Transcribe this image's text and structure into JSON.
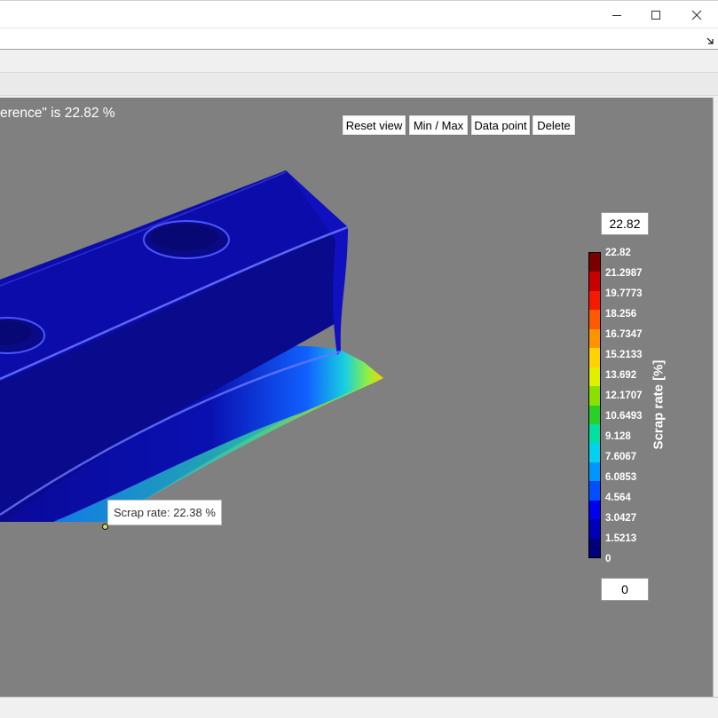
{
  "window": {
    "controls": [
      "minimize",
      "maximize",
      "close"
    ]
  },
  "viewport": {
    "heading": "erence\" is 22.82 %",
    "toolbar": {
      "reset_view": "Reset view",
      "min_max": "Min / Max",
      "data_point": "Data point",
      "delete": "Delete"
    },
    "tooltip": "Scrap rate: 22.38 %"
  },
  "color_scale": {
    "title": "Scrap rate [%]",
    "max_value": "22.82",
    "min_value": "0",
    "ticks": [
      "22.82",
      "21.2987",
      "19.7773",
      "18.256",
      "16.7347",
      "15.2133",
      "13.692",
      "12.1707",
      "10.6493",
      "9.128",
      "7.6067",
      "6.0853",
      "4.564",
      "3.0427",
      "1.5213",
      "0"
    ],
    "colors": [
      "#7a0000",
      "#c80000",
      "#f51a00",
      "#ff5a00",
      "#ff9400",
      "#ffd200",
      "#e2f000",
      "#8ce000",
      "#28d028",
      "#00e0a0",
      "#00d2f0",
      "#0096ff",
      "#0050ff",
      "#0000f0",
      "#0000b8",
      "#00007a"
    ]
  }
}
